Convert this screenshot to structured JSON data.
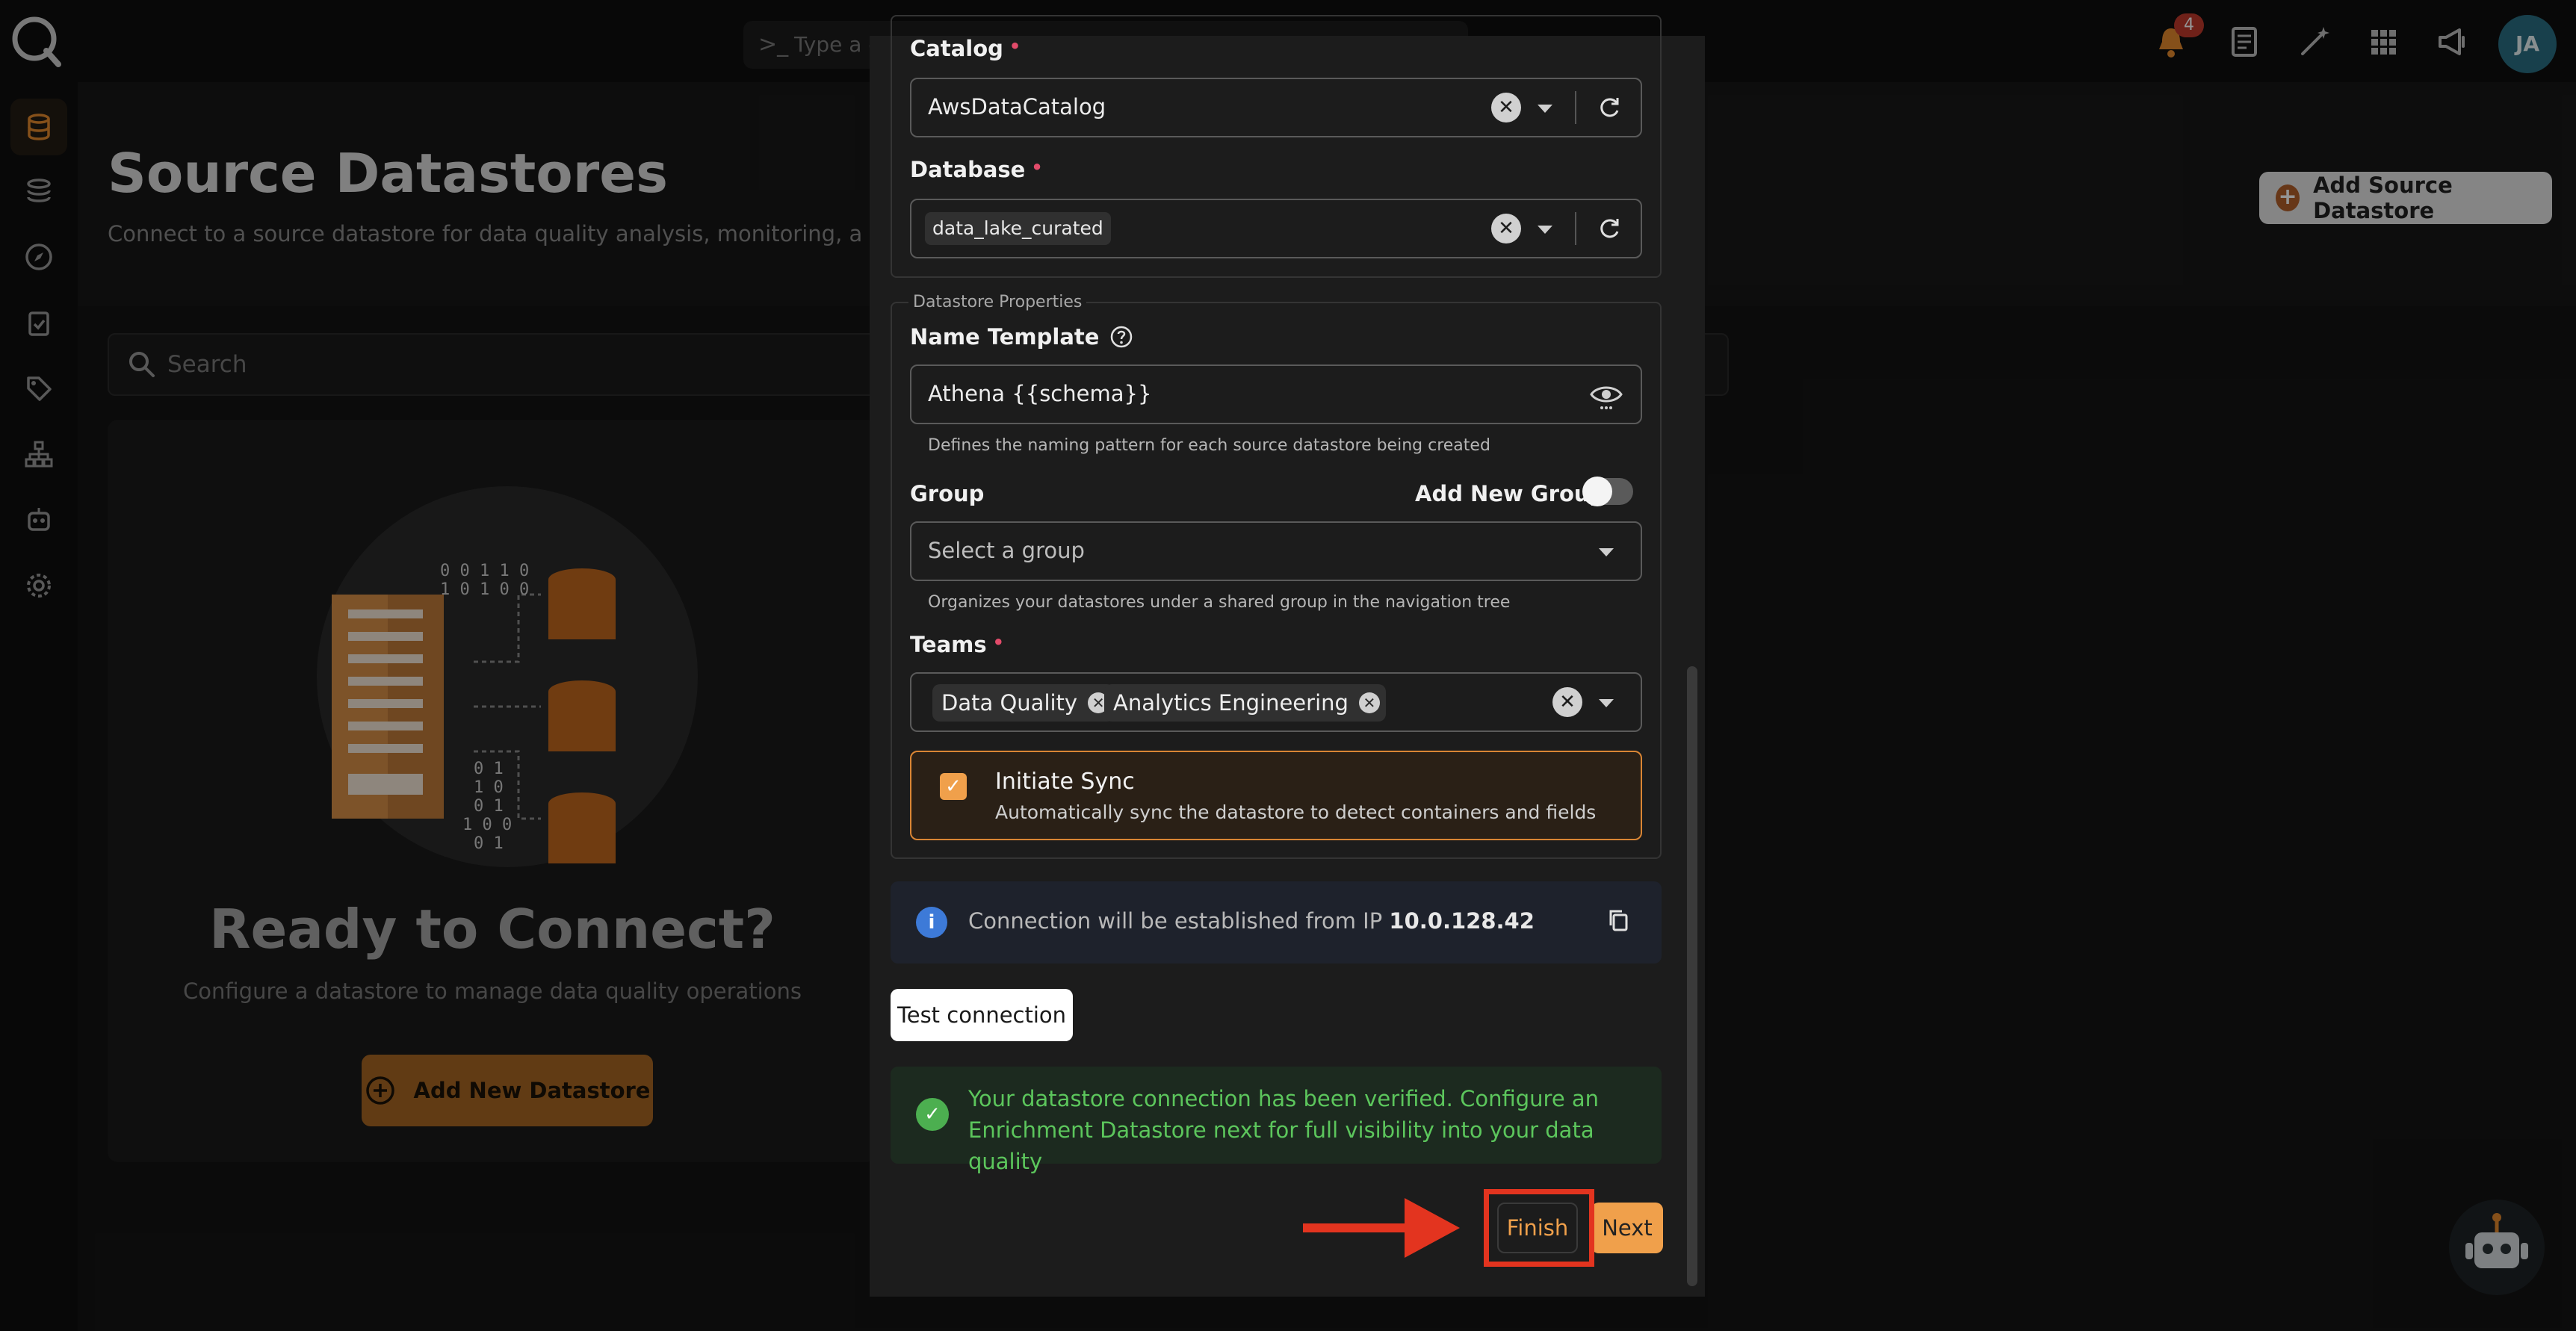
{
  "header": {
    "command_placeholder": "Type a c",
    "notifications_count": "4",
    "avatar_initials": "JA"
  },
  "page": {
    "title": "Source Datastores",
    "subtitle": "Connect to a source datastore for data quality analysis, monitoring, and anomal",
    "add_source_label": "Add Source Datastore",
    "search_placeholder": "Search",
    "empty_title": "Ready to Connect?",
    "empty_subtitle": "Configure a datastore to manage data quality operations",
    "add_new_label": "Add New Datastore",
    "illustration_bits": [
      "0 0 1 1 0",
      "1 0 1 0 0",
      "0 1",
      "1 0",
      "0 1",
      "1 0 0",
      "0 1"
    ]
  },
  "modal": {
    "catalog": {
      "label": "Catalog",
      "required": "•",
      "value": "AwsDataCatalog",
      "clear": "✕"
    },
    "database": {
      "label": "Database",
      "required": "•",
      "value": "data_lake_curated",
      "clear": "✕"
    },
    "properties_legend": "Datastore Properties",
    "name_template": {
      "label": "Name Template",
      "value": "Athena {{schema}}",
      "helper": "Defines the naming pattern for each source datastore being created"
    },
    "group": {
      "label": "Group",
      "add_new_group_label": "Add New Group",
      "placeholder": "Select a group",
      "helper": "Organizes your datastores under a shared group in the navigation tree"
    },
    "teams": {
      "label": "Teams",
      "required": "•",
      "selected": [
        "Data Quality",
        "Analytics Engineering"
      ],
      "clear": "✕",
      "chip_remove": "✕"
    },
    "initiate_sync": {
      "checked": "✓",
      "title": "Initiate Sync",
      "description": "Automatically sync the datastore to detect containers and fields"
    },
    "connection_info": {
      "icon": "i",
      "text": "Connection will be established from IP ",
      "ip": "10.0.128.42"
    },
    "test_connection_label": "Test connection",
    "success": {
      "icon": "✓",
      "message": "Your datastore connection has been verified. Configure an Enrichment Datastore next for full visibility into your data quality"
    },
    "finish_label": "Finish",
    "next_label": "Next"
  },
  "colors": {
    "accent": "#f0a04b",
    "highlight_red": "#e3341f",
    "success_green": "#5cc65c",
    "info_blue": "#3d7ad8",
    "required_pink": "#e24b6a"
  }
}
